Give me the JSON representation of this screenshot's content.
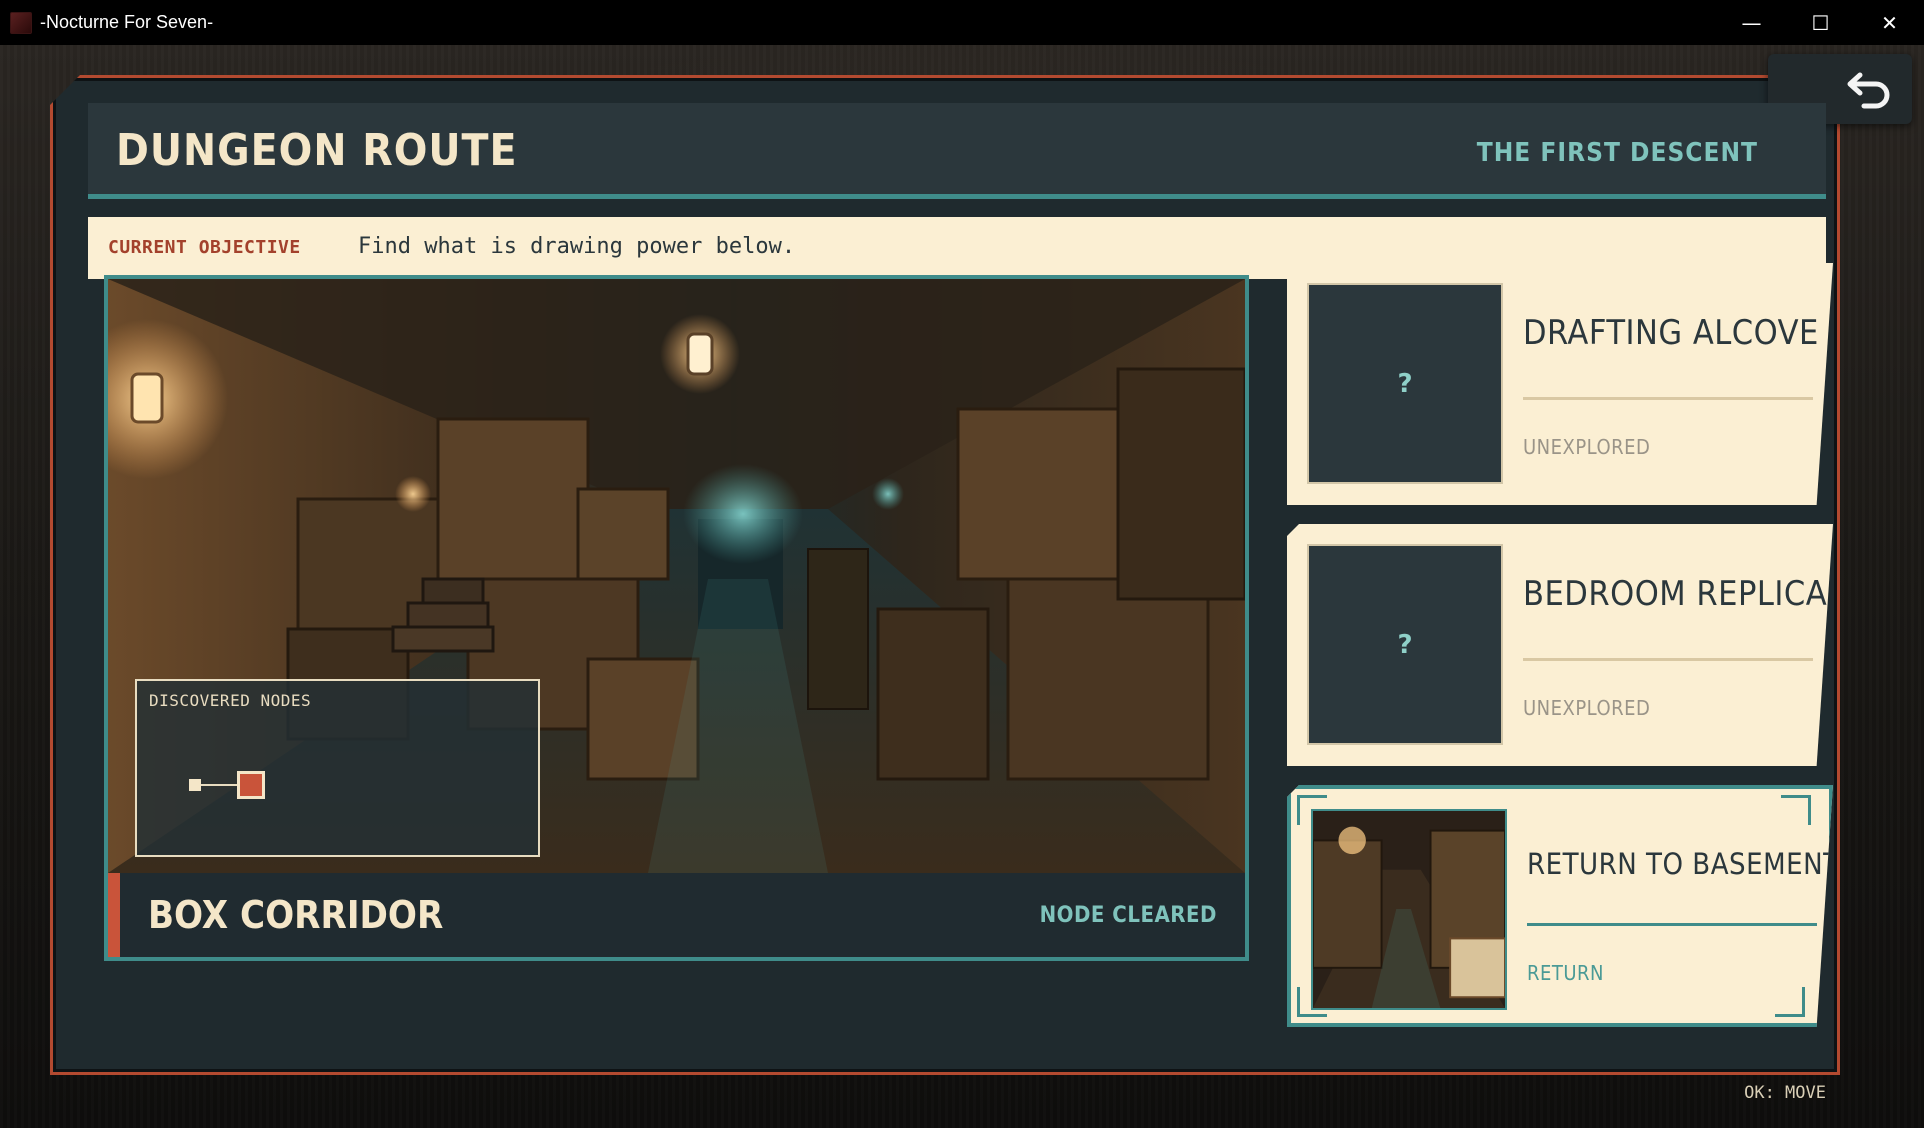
{
  "window": {
    "title": "-Nocturne For Seven-",
    "minimize": "—",
    "maximize": "☐",
    "close": "✕"
  },
  "header": {
    "title": "DUNGEON ROUTE",
    "subtitle": "THE FIRST DESCENT"
  },
  "objective": {
    "label": "CURRENT OBJECTIVE",
    "text": "Find what is drawing power below."
  },
  "scene": {
    "name": "BOX CORRIDOR",
    "status": "NODE CLEARED",
    "minimap_title": "DISCOVERED NODES"
  },
  "destinations": [
    {
      "title": "DRAFTING ALCOVE",
      "status": "UNEXPLORED",
      "thumb": "?"
    },
    {
      "title": "BEDROOM REPLICA",
      "status": "UNEXPLORED",
      "thumb": "?"
    },
    {
      "title": "RETURN TO BASEMENT THRESHOLD",
      "status": "RETURN",
      "thumb": ""
    }
  ],
  "hint": "OK: MOVE",
  "colors": {
    "accent_teal": "#3f8c8a",
    "accent_red": "#c9543a",
    "panel_dark": "#2b373c",
    "paper": "#fbefd3"
  }
}
